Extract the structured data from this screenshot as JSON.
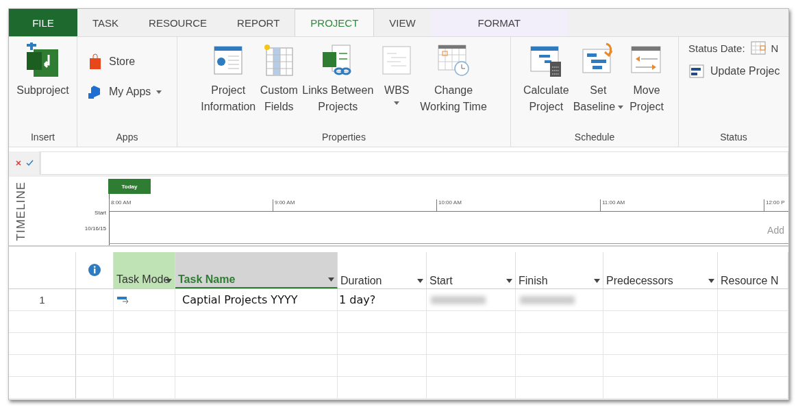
{
  "tabs": [
    {
      "label": "FILE",
      "kind": "file",
      "selected": false
    },
    {
      "label": "TASK",
      "kind": "normal",
      "selected": false
    },
    {
      "label": "RESOURCE",
      "kind": "normal",
      "selected": false
    },
    {
      "label": "REPORT",
      "kind": "normal",
      "selected": false
    },
    {
      "label": "PROJECT",
      "kind": "normal",
      "selected": true
    },
    {
      "label": "VIEW",
      "kind": "normal",
      "selected": false
    },
    {
      "label": "FORMAT",
      "kind": "contextual",
      "selected": false
    }
  ],
  "ribbon": {
    "groups": [
      {
        "label": "Insert",
        "buttons": [
          {
            "kind": "large",
            "lines": [
              "Subproject"
            ],
            "dropdown": false
          }
        ]
      },
      {
        "label": "Apps",
        "buttons": [
          {
            "kind": "small",
            "lines": [
              "Store"
            ],
            "dropdown": false
          },
          {
            "kind": "small",
            "lines": [
              "My Apps"
            ],
            "dropdown": true
          }
        ]
      },
      {
        "label": "Properties",
        "buttons": [
          {
            "kind": "large",
            "lines": [
              "Project",
              "Information"
            ],
            "dropdown": false
          },
          {
            "kind": "large",
            "lines": [
              "Custom",
              "Fields"
            ],
            "dropdown": false
          },
          {
            "kind": "large",
            "lines": [
              "Links Between",
              "Projects"
            ],
            "dropdown": false
          },
          {
            "kind": "large",
            "lines": [
              "WBS"
            ],
            "dropdown": true
          },
          {
            "kind": "large",
            "lines": [
              "Change",
              "Working Time"
            ],
            "dropdown": false
          }
        ]
      },
      {
        "label": "Schedule",
        "buttons": [
          {
            "kind": "large",
            "lines": [
              "Calculate",
              "Project"
            ],
            "dropdown": false
          },
          {
            "kind": "large",
            "lines": [
              "Set",
              "Baseline"
            ],
            "dropdown": true
          },
          {
            "kind": "large",
            "lines": [
              "Move",
              "Project"
            ],
            "dropdown": false
          }
        ]
      },
      {
        "label": "Status",
        "buttons": [
          {
            "kind": "field",
            "lines": [
              "Status Date:"
            ],
            "value": "N"
          },
          {
            "kind": "small",
            "lines": [
              "Update Projec"
            ],
            "dropdown": false
          }
        ]
      }
    ]
  },
  "timeline": {
    "label": "TIMELINE",
    "today": "Today",
    "start_label": "Start",
    "start_date": "10/16/15",
    "ticks": [
      "8:00 AM",
      "9:00 AM",
      "10:00 AM",
      "11:00 AM",
      "12:00 P"
    ],
    "hint": "Add"
  },
  "table": {
    "columns": [
      {
        "kind": "info",
        "selected": false
      },
      {
        "kind": "mode",
        "label": "Task Mode",
        "selected": false
      },
      {
        "kind": "name",
        "label": "Task Name",
        "selected": true
      },
      {
        "kind": "text",
        "label": "Duration",
        "selected": false
      },
      {
        "kind": "text",
        "label": "Start",
        "selected": false
      },
      {
        "kind": "text",
        "label": "Finish",
        "selected": false
      },
      {
        "kind": "text",
        "label": "Predecessors",
        "selected": false
      },
      {
        "kind": "cut",
        "label": "Resource N",
        "selected": false
      }
    ],
    "rows": [
      {
        "number": "1",
        "task_name": "Captial Projects YYYY",
        "duration": "1 day?",
        "dates_blurred": true
      }
    ]
  }
}
